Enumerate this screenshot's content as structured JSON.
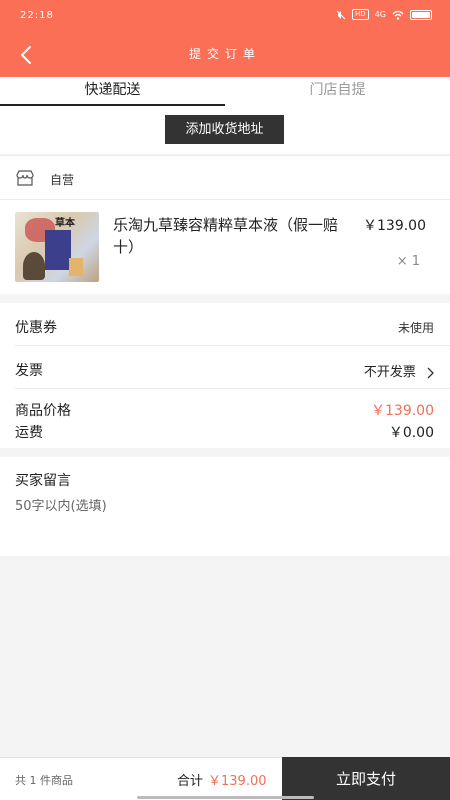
{
  "status": {
    "time": "22:18",
    "network": "4G",
    "hd": "HD",
    "battery": "93"
  },
  "header": {
    "title": "提交订单"
  },
  "tabs": [
    {
      "label": "快递配送"
    },
    {
      "label": "门店自提"
    }
  ],
  "address": {
    "add_label": "添加收货地址"
  },
  "store": {
    "name": "自营"
  },
  "product": {
    "name": "乐淘九草臻容精粹草本液（假一赔十）",
    "price": "￥139.00",
    "qty": "× 1",
    "image_text": "草本"
  },
  "fees": {
    "coupon_label": "优惠券",
    "coupon_value": "未使用",
    "invoice_label": "发票",
    "invoice_value": "不开发票",
    "goods_label": "商品价格",
    "goods_value": "￥139.00",
    "ship_label": "运费",
    "ship_value": "￥0.00"
  },
  "message": {
    "title": "买家留言",
    "placeholder": "50字以内(选填)"
  },
  "footer": {
    "count_text": "共 1 件商品",
    "total_label": "合计",
    "total_value": "￥139.00",
    "pay_label": "立即支付"
  },
  "colors": {
    "brand": "#fa6f56",
    "price": "#f26f55",
    "dark": "#333333"
  }
}
